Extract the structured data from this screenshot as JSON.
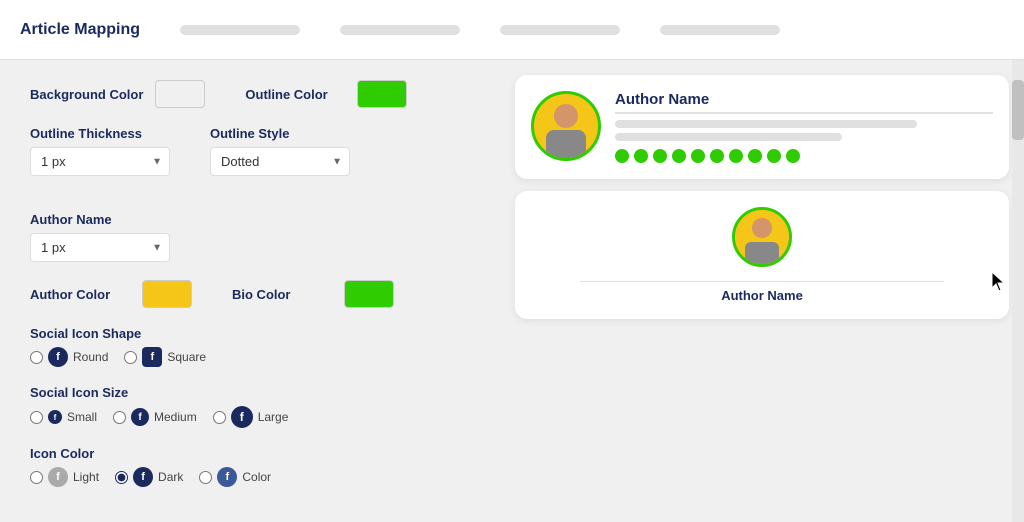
{
  "app": {
    "title": "Article Mapping",
    "tabs": [
      "",
      "",
      "",
      ""
    ]
  },
  "form": {
    "background_color_label": "Background Color",
    "outline_color_label": "Outline Color",
    "outline_thickness_label": "Outline Thickness",
    "outline_thickness_value": "1 px",
    "outline_style_label": "Outline Style",
    "outline_style_value": "Dotted",
    "author_name_label": "Author Name",
    "author_name_value": "1 px",
    "author_color_label": "Author Color",
    "bio_color_label": "Bio Color",
    "social_icon_shape_label": "Social Icon Shape",
    "social_icon_size_label": "Social Icon Size",
    "icon_color_label": "Icon Color",
    "shape_options": [
      "Round",
      "Square"
    ],
    "size_options": [
      "Small",
      "Medium",
      "Large"
    ],
    "icon_color_options": [
      "Light",
      "Dark",
      "Color"
    ]
  },
  "preview": {
    "card1_name": "Author Name",
    "card2_name": "Author Name",
    "social_dots_count": 10
  },
  "colors": {
    "accent_blue": "#1a2a5e",
    "green": "#2ecc00",
    "yellow": "#f5c518",
    "white": "#f0f0f0"
  }
}
